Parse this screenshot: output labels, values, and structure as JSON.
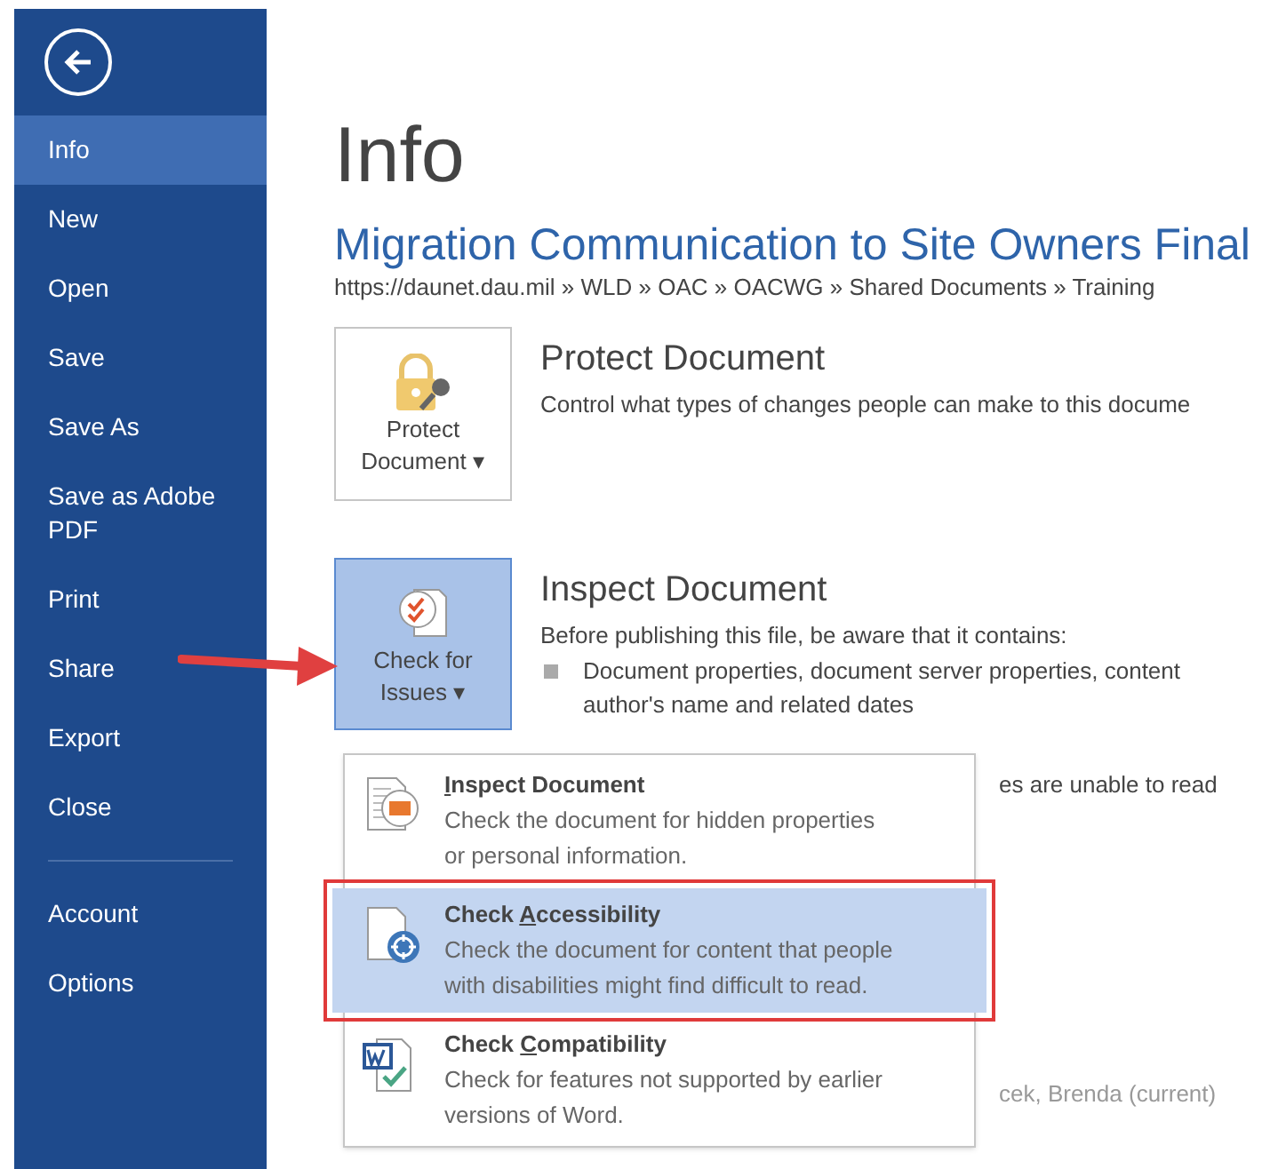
{
  "sidebar": {
    "items": [
      {
        "label": "Info",
        "selected": true
      },
      {
        "label": "New",
        "selected": false
      },
      {
        "label": "Open",
        "selected": false
      },
      {
        "label": "Save",
        "selected": false
      },
      {
        "label": "Save As",
        "selected": false
      },
      {
        "label": "Save as Adobe PDF",
        "selected": false
      },
      {
        "label": "Print",
        "selected": false
      },
      {
        "label": "Share",
        "selected": false
      },
      {
        "label": "Export",
        "selected": false
      },
      {
        "label": "Close",
        "selected": false
      },
      {
        "label": "Account",
        "selected": false,
        "divider_before": true
      },
      {
        "label": "Options",
        "selected": false
      }
    ]
  },
  "page_title": "Info",
  "document_title": "Migration Communication to Site Owners Final",
  "breadcrumb": "https://daunet.dau.mil » WLD » OAC » OACWG » Shared Documents » Training",
  "protect": {
    "button_line1": "Protect",
    "button_line2": "Document",
    "caret": "▾",
    "heading": "Protect Document",
    "description": "Control what types of changes people can make to this docume"
  },
  "inspect": {
    "button_line1": "Check for",
    "button_line2": "Issues",
    "caret": "▾",
    "pressed": true,
    "heading": "Inspect Document",
    "description": "Before publishing this file, be aware that it contains:",
    "bullet": "Document properties, document server properties, content",
    "bullet_cont": "author's name and related dates",
    "hidden_text_1": "es are unable to read",
    "hidden_text_2": "cek, Brenda (current)"
  },
  "menu": [
    {
      "kind": "inspect",
      "access_key": "I",
      "title_end": "nspect Document",
      "description": [
        "Check the document for hidden properties",
        "or personal information."
      ],
      "selected": false
    },
    {
      "kind": "accessibility",
      "title_start": "Check ",
      "access_key": "A",
      "title_end": "ccessibility",
      "description": [
        "Check the document for content that people",
        "with disabilities might find difficult to read."
      ],
      "selected": true
    },
    {
      "kind": "compatibility",
      "title_start": "Check ",
      "access_key": "C",
      "title_end": "ompatibility",
      "description": [
        "Check for features not supported by earlier",
        "versions of Word."
      ],
      "selected": false
    }
  ]
}
